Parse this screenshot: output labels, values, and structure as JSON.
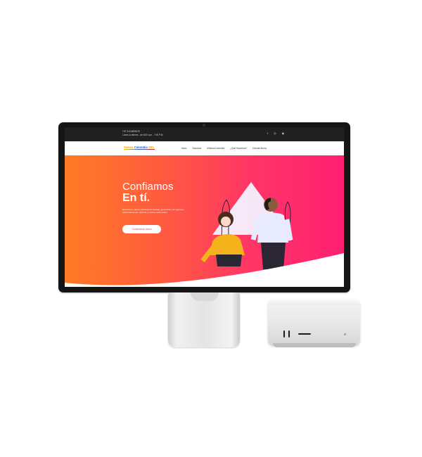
{
  "site": {
    "contact": {
      "phone": "+57 310 8899070",
      "hours": "Lunes a viernes - de 8:00 a.m - 7:00 P.M"
    },
    "social_icons": [
      "facebook-icon",
      "instagram-icon",
      "social-icon"
    ],
    "logo": {
      "part1": "Vamos",
      "part2": "Colombia",
      "part3": "SRL"
    },
    "nav": [
      "Inicio",
      "Nosotros",
      "#VamosColombia",
      "¿Qué Hacemos?",
      "Dónate Ahora"
    ],
    "hero": {
      "title_line1": "Confiamos",
      "title_line2": "En tí.",
      "text": "Educación, salud, planificación familiar, generación de ingresos, emprendimiento, deporte y cultura. Para todos.",
      "cta": "Contactános ahora"
    }
  },
  "colors": {
    "hero_start": "#ff7a24",
    "hero_end": "#ff1f73",
    "monitor_bezel": "#151515",
    "topbar": "#202020",
    "cta_text": "#e0485f"
  }
}
